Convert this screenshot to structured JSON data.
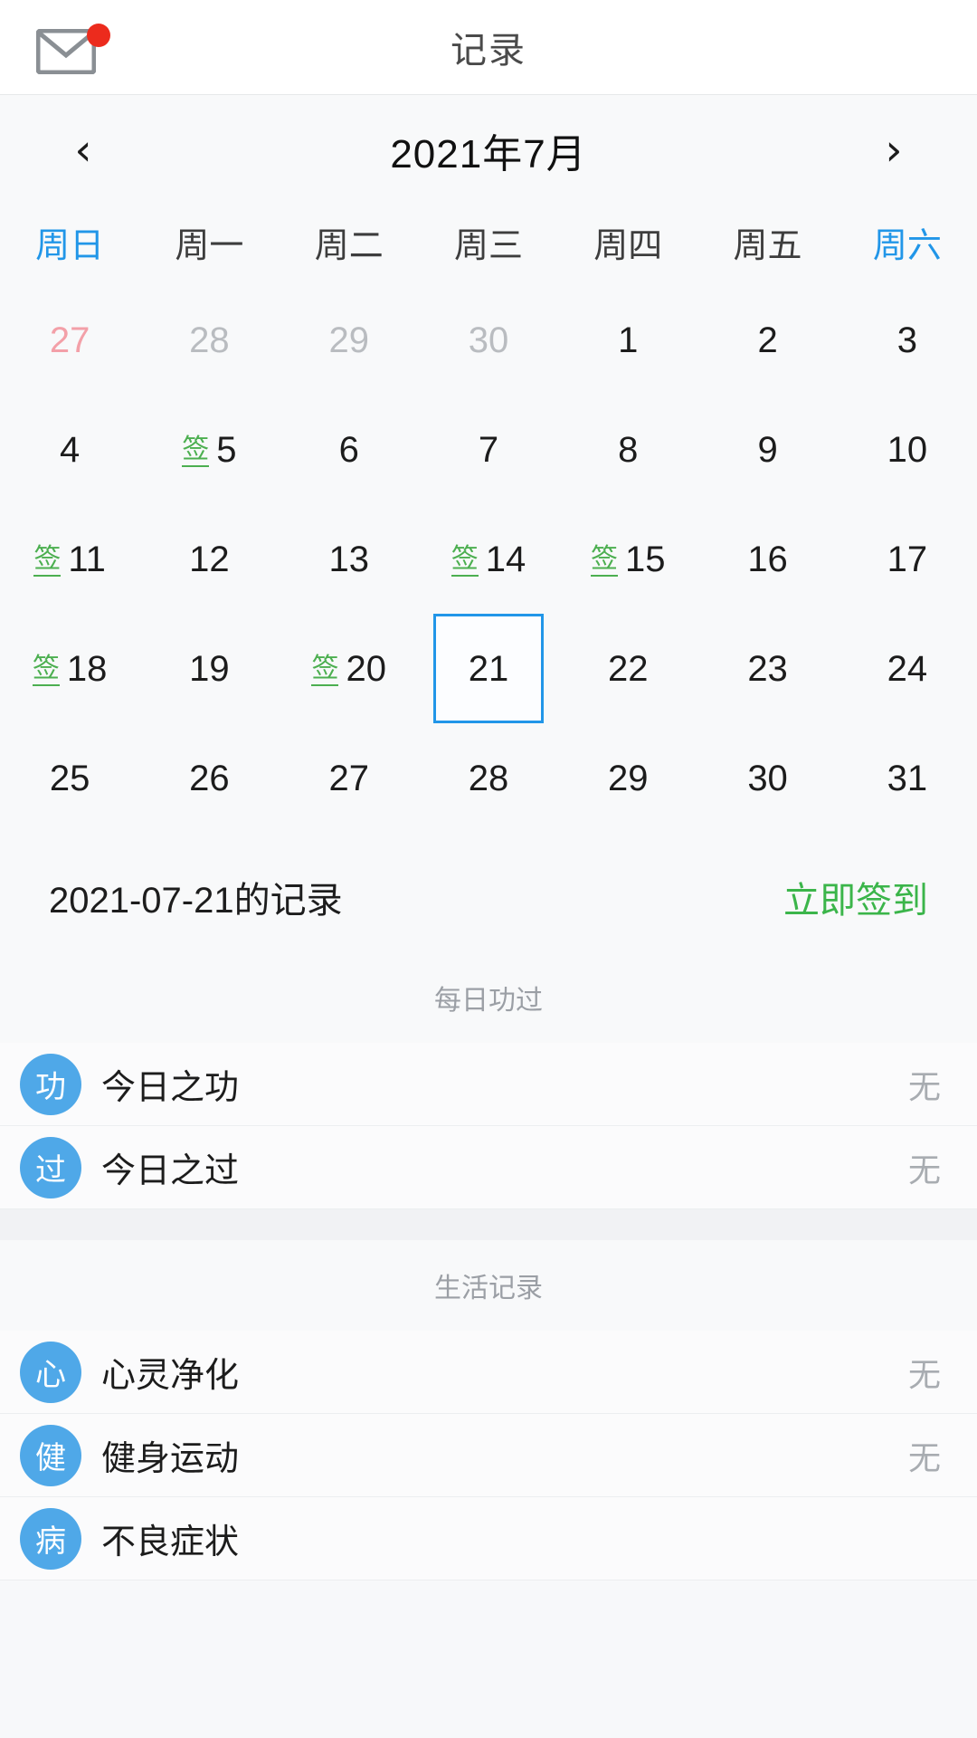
{
  "header": {
    "title": "记录",
    "mail_icon": "mail-icon",
    "badge": ""
  },
  "calendar": {
    "prev_label": "‹",
    "next_label": "›",
    "month_label": "2021年7月",
    "weekdays": [
      {
        "label": "周日",
        "weekend": true
      },
      {
        "label": "周一",
        "weekend": false
      },
      {
        "label": "周二",
        "weekend": false
      },
      {
        "label": "周三",
        "weekend": false
      },
      {
        "label": "周四",
        "weekend": false
      },
      {
        "label": "周五",
        "weekend": false
      },
      {
        "label": "周六",
        "weekend": true
      }
    ],
    "sign_mark": "签",
    "selected_color": "#2196e8",
    "sign_color": "#4caf50",
    "days": [
      {
        "n": "27",
        "state": "other-red",
        "sign": false,
        "selected": false
      },
      {
        "n": "28",
        "state": "other",
        "sign": false,
        "selected": false
      },
      {
        "n": "29",
        "state": "other",
        "sign": false,
        "selected": false
      },
      {
        "n": "30",
        "state": "other",
        "sign": false,
        "selected": false
      },
      {
        "n": "1",
        "state": "current",
        "sign": false,
        "selected": false
      },
      {
        "n": "2",
        "state": "current",
        "sign": false,
        "selected": false
      },
      {
        "n": "3",
        "state": "current",
        "sign": false,
        "selected": false
      },
      {
        "n": "4",
        "state": "current",
        "sign": false,
        "selected": false
      },
      {
        "n": "5",
        "state": "current",
        "sign": true,
        "selected": false
      },
      {
        "n": "6",
        "state": "current",
        "sign": false,
        "selected": false
      },
      {
        "n": "7",
        "state": "current",
        "sign": false,
        "selected": false
      },
      {
        "n": "8",
        "state": "current",
        "sign": false,
        "selected": false
      },
      {
        "n": "9",
        "state": "current",
        "sign": false,
        "selected": false
      },
      {
        "n": "10",
        "state": "current",
        "sign": false,
        "selected": false
      },
      {
        "n": "11",
        "state": "current",
        "sign": true,
        "selected": false
      },
      {
        "n": "12",
        "state": "current",
        "sign": false,
        "selected": false
      },
      {
        "n": "13",
        "state": "current",
        "sign": false,
        "selected": false
      },
      {
        "n": "14",
        "state": "current",
        "sign": true,
        "selected": false
      },
      {
        "n": "15",
        "state": "current",
        "sign": true,
        "selected": false
      },
      {
        "n": "16",
        "state": "current",
        "sign": false,
        "selected": false
      },
      {
        "n": "17",
        "state": "current",
        "sign": false,
        "selected": false
      },
      {
        "n": "18",
        "state": "current",
        "sign": true,
        "selected": false
      },
      {
        "n": "19",
        "state": "current",
        "sign": false,
        "selected": false
      },
      {
        "n": "20",
        "state": "current",
        "sign": true,
        "selected": false
      },
      {
        "n": "21",
        "state": "current",
        "sign": false,
        "selected": true
      },
      {
        "n": "22",
        "state": "current",
        "sign": false,
        "selected": false
      },
      {
        "n": "23",
        "state": "current",
        "sign": false,
        "selected": false
      },
      {
        "n": "24",
        "state": "current",
        "sign": false,
        "selected": false
      },
      {
        "n": "25",
        "state": "current",
        "sign": false,
        "selected": false
      },
      {
        "n": "26",
        "state": "current",
        "sign": false,
        "selected": false
      },
      {
        "n": "27",
        "state": "current",
        "sign": false,
        "selected": false
      },
      {
        "n": "28",
        "state": "current",
        "sign": false,
        "selected": false
      },
      {
        "n": "29",
        "state": "current",
        "sign": false,
        "selected": false
      },
      {
        "n": "30",
        "state": "current",
        "sign": false,
        "selected": false
      },
      {
        "n": "31",
        "state": "current",
        "sign": false,
        "selected": false
      }
    ]
  },
  "record": {
    "date_label": "2021-07-21的记录",
    "sign_now_label": "立即签到"
  },
  "sections": [
    {
      "title": "每日功过",
      "items": [
        {
          "avatar": "功",
          "label": "今日之功",
          "value": "无"
        },
        {
          "avatar": "过",
          "label": "今日之过",
          "value": "无"
        }
      ]
    },
    {
      "title": "生活记录",
      "items": [
        {
          "avatar": "心",
          "label": "心灵净化",
          "value": "无"
        },
        {
          "avatar": "健",
          "label": "健身运动",
          "value": "无"
        },
        {
          "avatar": "病",
          "label": "不良症状",
          "value": ""
        }
      ]
    }
  ]
}
